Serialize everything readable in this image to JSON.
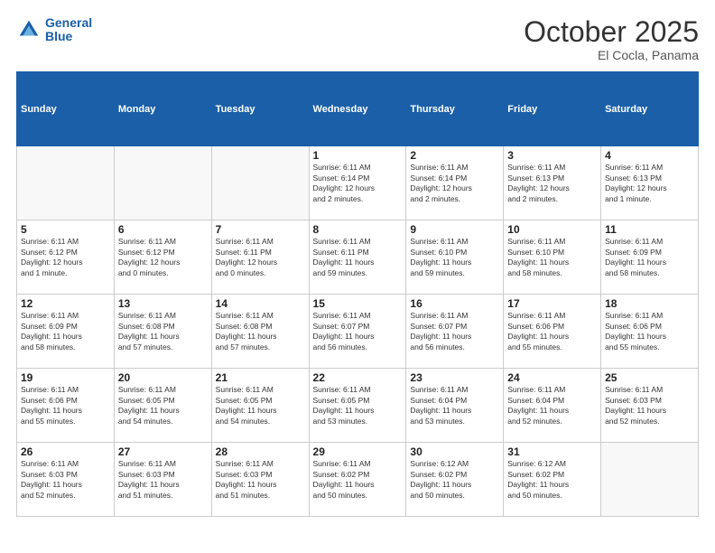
{
  "header": {
    "logo_line1": "General",
    "logo_line2": "Blue",
    "month_title": "October 2025",
    "location": "El Cocla, Panama"
  },
  "weekdays": [
    "Sunday",
    "Monday",
    "Tuesday",
    "Wednesday",
    "Thursday",
    "Friday",
    "Saturday"
  ],
  "weeks": [
    [
      {
        "day": "",
        "info": ""
      },
      {
        "day": "",
        "info": ""
      },
      {
        "day": "",
        "info": ""
      },
      {
        "day": "1",
        "info": "Sunrise: 6:11 AM\nSunset: 6:14 PM\nDaylight: 12 hours\nand 2 minutes."
      },
      {
        "day": "2",
        "info": "Sunrise: 6:11 AM\nSunset: 6:14 PM\nDaylight: 12 hours\nand 2 minutes."
      },
      {
        "day": "3",
        "info": "Sunrise: 6:11 AM\nSunset: 6:13 PM\nDaylight: 12 hours\nand 2 minutes."
      },
      {
        "day": "4",
        "info": "Sunrise: 6:11 AM\nSunset: 6:13 PM\nDaylight: 12 hours\nand 1 minute."
      }
    ],
    [
      {
        "day": "5",
        "info": "Sunrise: 6:11 AM\nSunset: 6:12 PM\nDaylight: 12 hours\nand 1 minute."
      },
      {
        "day": "6",
        "info": "Sunrise: 6:11 AM\nSunset: 6:12 PM\nDaylight: 12 hours\nand 0 minutes."
      },
      {
        "day": "7",
        "info": "Sunrise: 6:11 AM\nSunset: 6:11 PM\nDaylight: 12 hours\nand 0 minutes."
      },
      {
        "day": "8",
        "info": "Sunrise: 6:11 AM\nSunset: 6:11 PM\nDaylight: 11 hours\nand 59 minutes."
      },
      {
        "day": "9",
        "info": "Sunrise: 6:11 AM\nSunset: 6:10 PM\nDaylight: 11 hours\nand 59 minutes."
      },
      {
        "day": "10",
        "info": "Sunrise: 6:11 AM\nSunset: 6:10 PM\nDaylight: 11 hours\nand 58 minutes."
      },
      {
        "day": "11",
        "info": "Sunrise: 6:11 AM\nSunset: 6:09 PM\nDaylight: 11 hours\nand 58 minutes."
      }
    ],
    [
      {
        "day": "12",
        "info": "Sunrise: 6:11 AM\nSunset: 6:09 PM\nDaylight: 11 hours\nand 58 minutes."
      },
      {
        "day": "13",
        "info": "Sunrise: 6:11 AM\nSunset: 6:08 PM\nDaylight: 11 hours\nand 57 minutes."
      },
      {
        "day": "14",
        "info": "Sunrise: 6:11 AM\nSunset: 6:08 PM\nDaylight: 11 hours\nand 57 minutes."
      },
      {
        "day": "15",
        "info": "Sunrise: 6:11 AM\nSunset: 6:07 PM\nDaylight: 11 hours\nand 56 minutes."
      },
      {
        "day": "16",
        "info": "Sunrise: 6:11 AM\nSunset: 6:07 PM\nDaylight: 11 hours\nand 56 minutes."
      },
      {
        "day": "17",
        "info": "Sunrise: 6:11 AM\nSunset: 6:06 PM\nDaylight: 11 hours\nand 55 minutes."
      },
      {
        "day": "18",
        "info": "Sunrise: 6:11 AM\nSunset: 6:06 PM\nDaylight: 11 hours\nand 55 minutes."
      }
    ],
    [
      {
        "day": "19",
        "info": "Sunrise: 6:11 AM\nSunset: 6:06 PM\nDaylight: 11 hours\nand 55 minutes."
      },
      {
        "day": "20",
        "info": "Sunrise: 6:11 AM\nSunset: 6:05 PM\nDaylight: 11 hours\nand 54 minutes."
      },
      {
        "day": "21",
        "info": "Sunrise: 6:11 AM\nSunset: 6:05 PM\nDaylight: 11 hours\nand 54 minutes."
      },
      {
        "day": "22",
        "info": "Sunrise: 6:11 AM\nSunset: 6:05 PM\nDaylight: 11 hours\nand 53 minutes."
      },
      {
        "day": "23",
        "info": "Sunrise: 6:11 AM\nSunset: 6:04 PM\nDaylight: 11 hours\nand 53 minutes."
      },
      {
        "day": "24",
        "info": "Sunrise: 6:11 AM\nSunset: 6:04 PM\nDaylight: 11 hours\nand 52 minutes."
      },
      {
        "day": "25",
        "info": "Sunrise: 6:11 AM\nSunset: 6:03 PM\nDaylight: 11 hours\nand 52 minutes."
      }
    ],
    [
      {
        "day": "26",
        "info": "Sunrise: 6:11 AM\nSunset: 6:03 PM\nDaylight: 11 hours\nand 52 minutes."
      },
      {
        "day": "27",
        "info": "Sunrise: 6:11 AM\nSunset: 6:03 PM\nDaylight: 11 hours\nand 51 minutes."
      },
      {
        "day": "28",
        "info": "Sunrise: 6:11 AM\nSunset: 6:03 PM\nDaylight: 11 hours\nand 51 minutes."
      },
      {
        "day": "29",
        "info": "Sunrise: 6:11 AM\nSunset: 6:02 PM\nDaylight: 11 hours\nand 50 minutes."
      },
      {
        "day": "30",
        "info": "Sunrise: 6:12 AM\nSunset: 6:02 PM\nDaylight: 11 hours\nand 50 minutes."
      },
      {
        "day": "31",
        "info": "Sunrise: 6:12 AM\nSunset: 6:02 PM\nDaylight: 11 hours\nand 50 minutes."
      },
      {
        "day": "",
        "info": ""
      }
    ]
  ]
}
